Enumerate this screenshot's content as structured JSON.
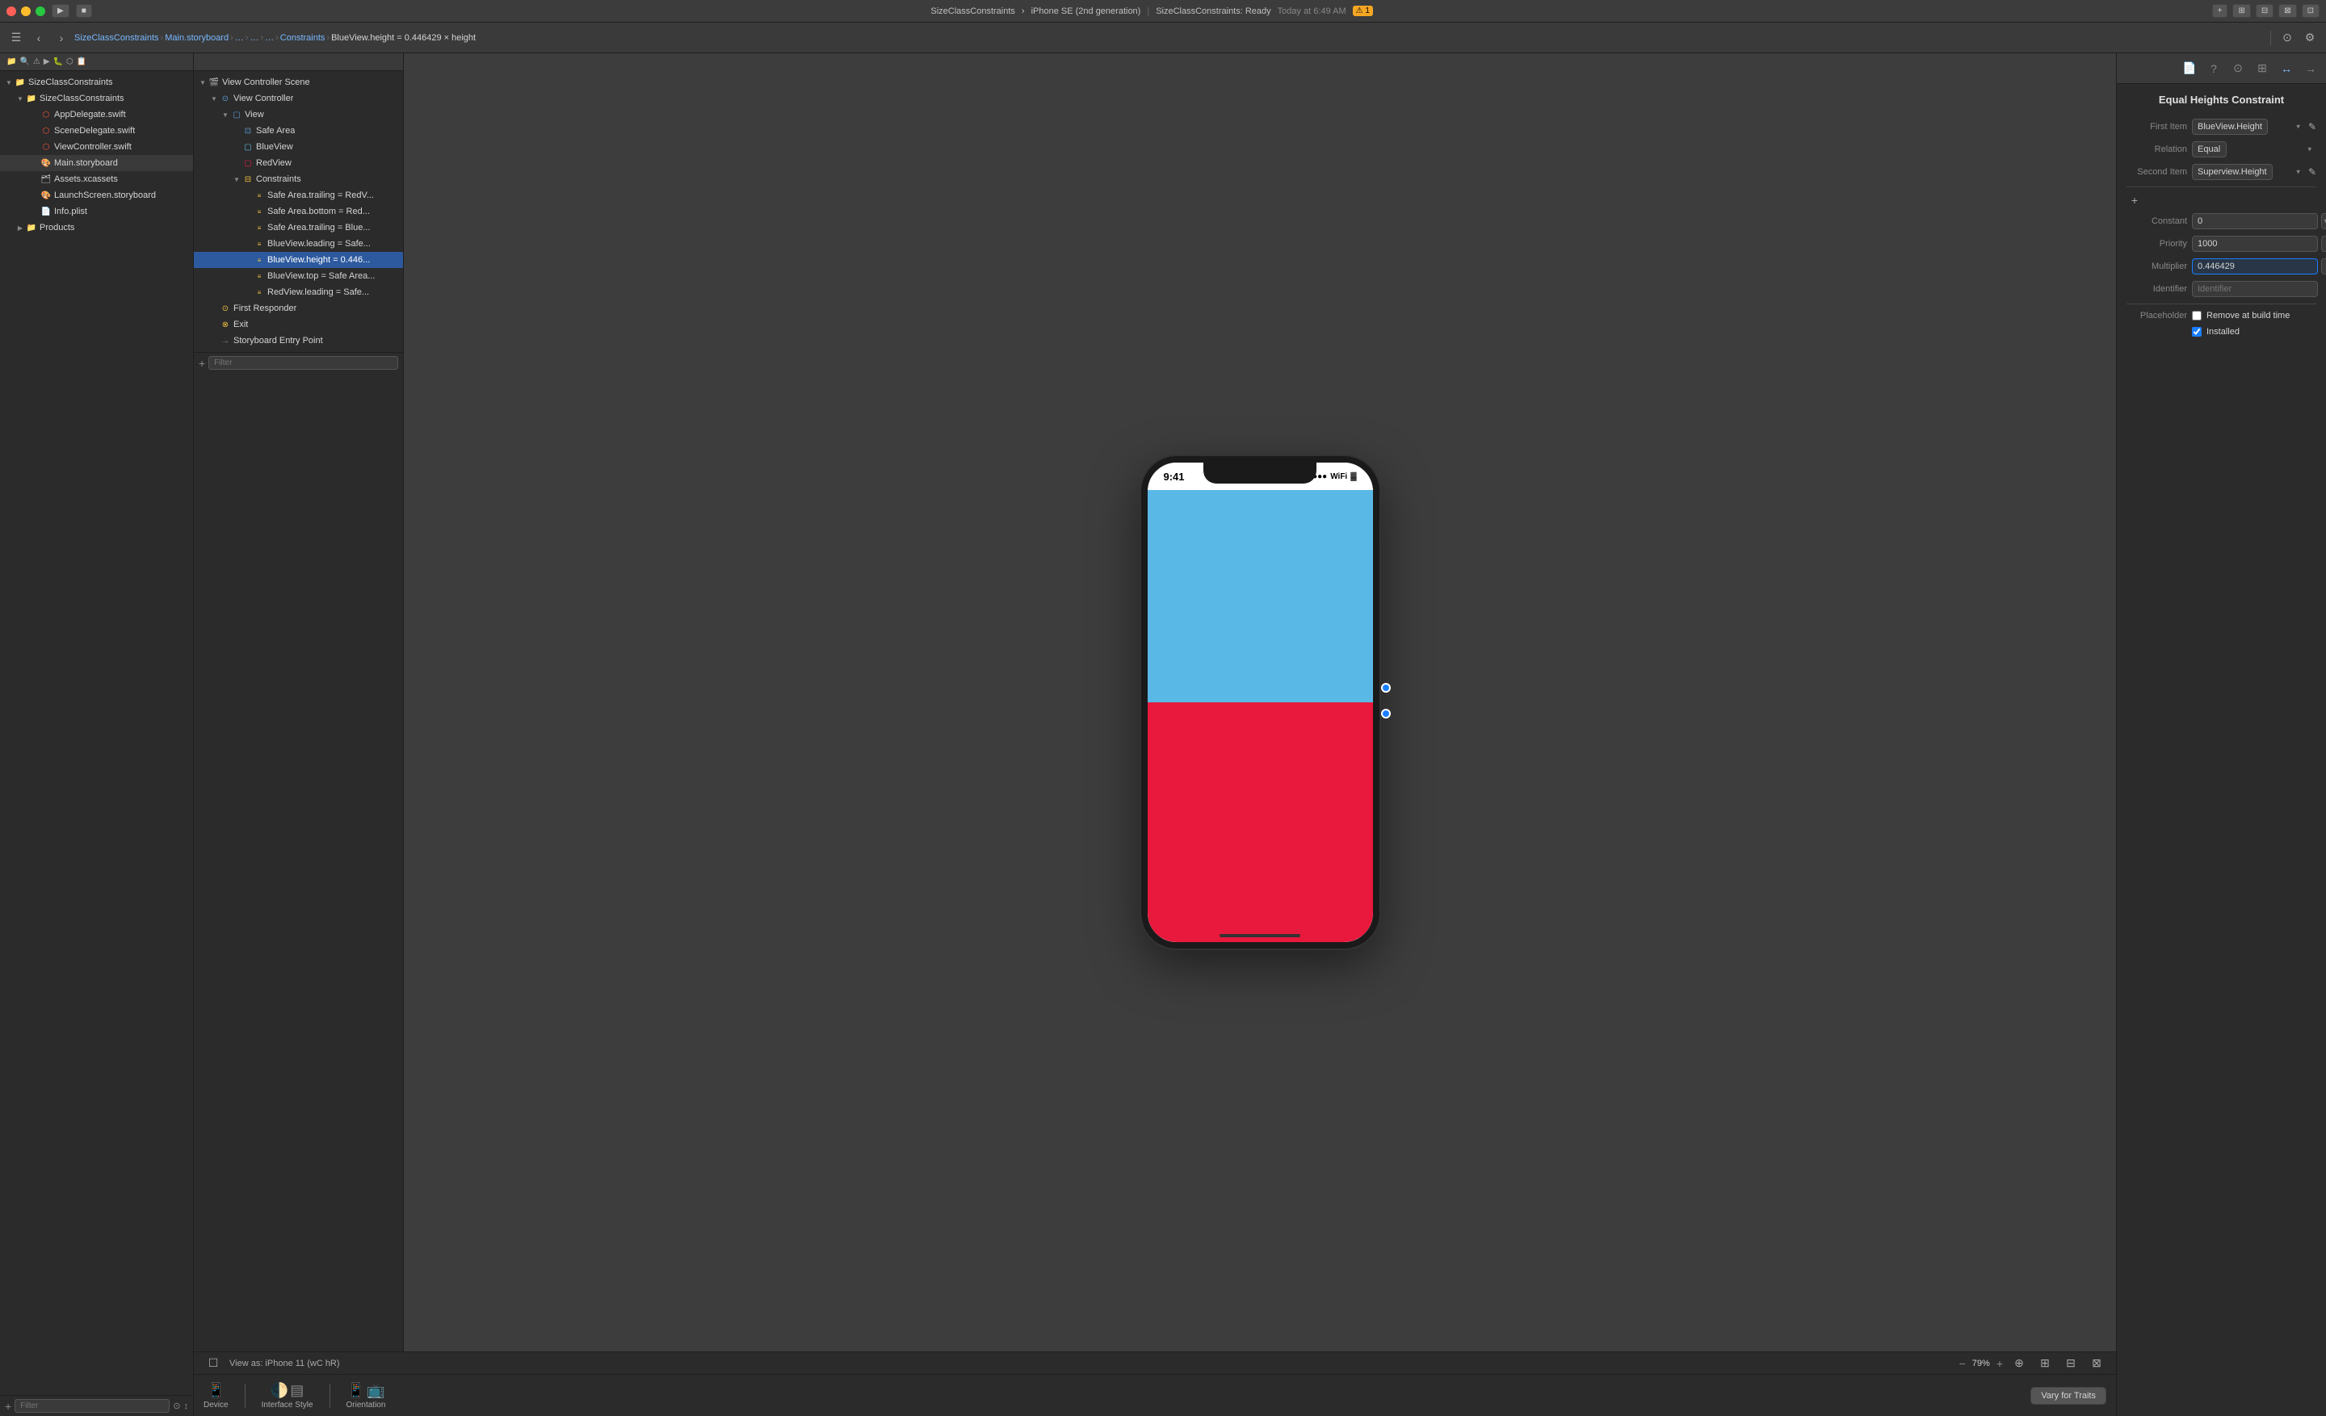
{
  "titleBar": {
    "trafficLights": [
      "red",
      "yellow",
      "green"
    ],
    "runButton": "▶",
    "projectName": "SizeClassConstraints",
    "deviceName": "iPhone SE (2nd generation)",
    "status": "SizeClassConstraints: Ready",
    "timestamp": "Today at 6:49 AM",
    "warningCount": "1",
    "addButton": "+",
    "windowControls": [
      "⊞",
      "⊟",
      "⊠",
      "⊡"
    ]
  },
  "toolbar": {
    "breadcrumb": [
      "SizeClassConstraints",
      "Main.storyboard",
      "…",
      "…",
      "…",
      "Constraints",
      "BlueView.height = 0.446429 × height"
    ]
  },
  "fileNavigator": {
    "title": "SizeClassConstraints",
    "items": [
      {
        "id": "root",
        "label": "SizeClassConstraints",
        "type": "folder",
        "level": 0,
        "expanded": true
      },
      {
        "id": "group",
        "label": "SizeClassConstraints",
        "type": "group-folder",
        "level": 1,
        "expanded": true
      },
      {
        "id": "appdelegate",
        "label": "AppDelegate.swift",
        "type": "swift",
        "level": 2
      },
      {
        "id": "scenedelegate",
        "label": "SceneDelegate.swift",
        "type": "swift",
        "level": 2
      },
      {
        "id": "viewcontroller",
        "label": "ViewController.swift",
        "type": "swift",
        "level": 2
      },
      {
        "id": "mainstoryboard",
        "label": "Main.storyboard",
        "type": "storyboard",
        "level": 2
      },
      {
        "id": "assets",
        "label": "Assets.xcassets",
        "type": "assets",
        "level": 2
      },
      {
        "id": "launchscreen",
        "label": "LaunchScreen.storyboard",
        "type": "storyboard",
        "level": 2
      },
      {
        "id": "infoplist",
        "label": "Info.plist",
        "type": "plist",
        "level": 2
      },
      {
        "id": "products",
        "label": "Products",
        "type": "folder",
        "level": 1,
        "expanded": false
      }
    ],
    "filterPlaceholder": "Filter"
  },
  "sceneNavigator": {
    "items": [
      {
        "id": "vcscene",
        "label": "View Controller Scene",
        "type": "scene",
        "level": 0,
        "expanded": true
      },
      {
        "id": "vc",
        "label": "View Controller",
        "type": "viewcontroller",
        "level": 1,
        "expanded": true
      },
      {
        "id": "view",
        "label": "View",
        "type": "view",
        "level": 2,
        "expanded": true
      },
      {
        "id": "safearea",
        "label": "Safe Area",
        "type": "safearea",
        "level": 3
      },
      {
        "id": "blueview",
        "label": "BlueView",
        "type": "view",
        "level": 3
      },
      {
        "id": "redview",
        "label": "RedView",
        "type": "view",
        "level": 3
      },
      {
        "id": "constraints",
        "label": "Constraints",
        "type": "constraints",
        "level": 3,
        "expanded": true
      },
      {
        "id": "c1",
        "label": "Safe Area.trailing = RedV...",
        "type": "constraint",
        "level": 4
      },
      {
        "id": "c2",
        "label": "Safe Area.bottom = Red...",
        "type": "constraint",
        "level": 4
      },
      {
        "id": "c3",
        "label": "Safe Area.trailing = Blue...",
        "type": "constraint",
        "level": 4
      },
      {
        "id": "c4",
        "label": "BlueView.leading = Safe...",
        "type": "constraint",
        "level": 4
      },
      {
        "id": "c5",
        "label": "BlueView.height = 0.446...",
        "type": "constraint",
        "level": 4,
        "selected": true
      },
      {
        "id": "c6",
        "label": "BlueView.top = Safe Area...",
        "type": "constraint",
        "level": 4
      },
      {
        "id": "c7",
        "label": "RedView.leading = Safe...",
        "type": "constraint",
        "level": 4
      },
      {
        "id": "firstresponder",
        "label": "First Responder",
        "type": "responder",
        "level": 1
      },
      {
        "id": "exit",
        "label": "Exit",
        "type": "exit",
        "level": 1
      },
      {
        "id": "entrypoint",
        "label": "Storyboard Entry Point",
        "type": "entry",
        "level": 1
      }
    ],
    "filterPlaceholder": "Filter"
  },
  "canvas": {
    "phone": {
      "time": "9:41",
      "blueColor": "#5ab8e6",
      "redColor": "#e8193c",
      "blueHeightPercent": 47
    },
    "zoom": "79%",
    "viewAs": "View as: iPhone 11 (wC hR)"
  },
  "deviceBar": {
    "deviceLabel": "Device",
    "interfaceStyleLabel": "Interface Style",
    "orientationLabel": "Orientation",
    "varyButton": "Vary for Traits"
  },
  "inspector": {
    "title": "Equal Heights Constraint",
    "fields": {
      "firstItemLabel": "First Item",
      "firstItemValue": "BlueView.Height",
      "relationLabel": "Relation",
      "relationValue": "Equal",
      "secondItemLabel": "Second Item",
      "secondItemValue": "Superview.Height",
      "constantLabel": "Constant",
      "constantValue": "0",
      "priorityLabel": "Priority",
      "priorityValue": "1000",
      "multiplierLabel": "Multiplier",
      "multiplierValue": "0.446429",
      "identifierLabel": "Identifier",
      "identifierPlaceholder": "Identifier",
      "placeholderLabel": "Placeholder",
      "placeholderCheckText": "Remove at build time",
      "installedLabel": "",
      "installedCheckText": "Installed"
    }
  }
}
